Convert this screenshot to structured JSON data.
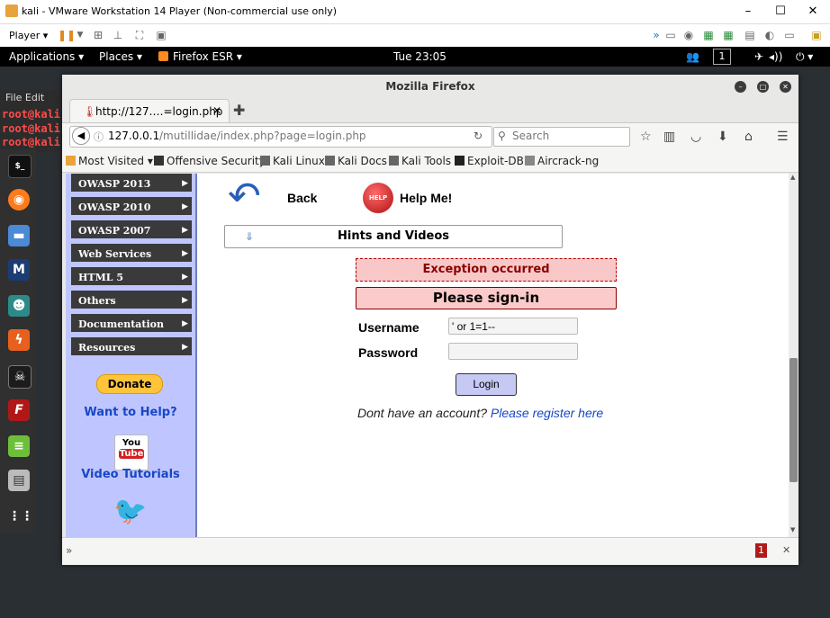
{
  "vm": {
    "title": "kali - VMware Workstation 14 Player (Non-commercial use only)",
    "player_label": "Player ▾",
    "min": "–",
    "max": "☐",
    "close": "✕"
  },
  "kali_panel": {
    "applications": "Applications ▾",
    "places": "Places ▾",
    "firefox": "Firefox ESR ▾",
    "clock": "Tue 23:05",
    "workspace": "1"
  },
  "terminal": {
    "menu": "File  Edit",
    "lines": [
      "root@kali",
      "root@kali",
      "root@kali"
    ]
  },
  "firefox": {
    "title": "Mozilla Firefox",
    "tab_title": "http://127.…=login.php",
    "url_host": "127.0.0.1",
    "url_path": "/mutillidae/index.php?page=login.php",
    "search_placeholder": "Search",
    "bookmarks": [
      "Most Visited ▾",
      "Offensive Security",
      "Kali Linux",
      "Kali Docs",
      "Kali Tools",
      "Exploit-DB",
      "Aircrack-ng"
    ],
    "status_badge": "1"
  },
  "sidebar": {
    "items": [
      "OWASP 2013",
      "OWASP 2010",
      "OWASP 2007",
      "Web Services",
      "HTML 5",
      "Others",
      "Documentation",
      "Resources"
    ],
    "donate": "Donate",
    "want_help": "Want to Help?",
    "yt_line1": "You",
    "yt_line2": "Tube",
    "video_tutorials": "Video Tutorials"
  },
  "main": {
    "back": "Back",
    "help": "Help Me!",
    "help_badge": "HELP",
    "hints": "Hints and Videos",
    "exception": "Exception occurred",
    "signin": "Please sign-in",
    "username_label": "Username",
    "username_value": "' or 1=1--",
    "password_label": "Password",
    "password_value": "",
    "login_button": "Login",
    "no_account": "Dont have an account?",
    "register_link": "Please register here"
  }
}
